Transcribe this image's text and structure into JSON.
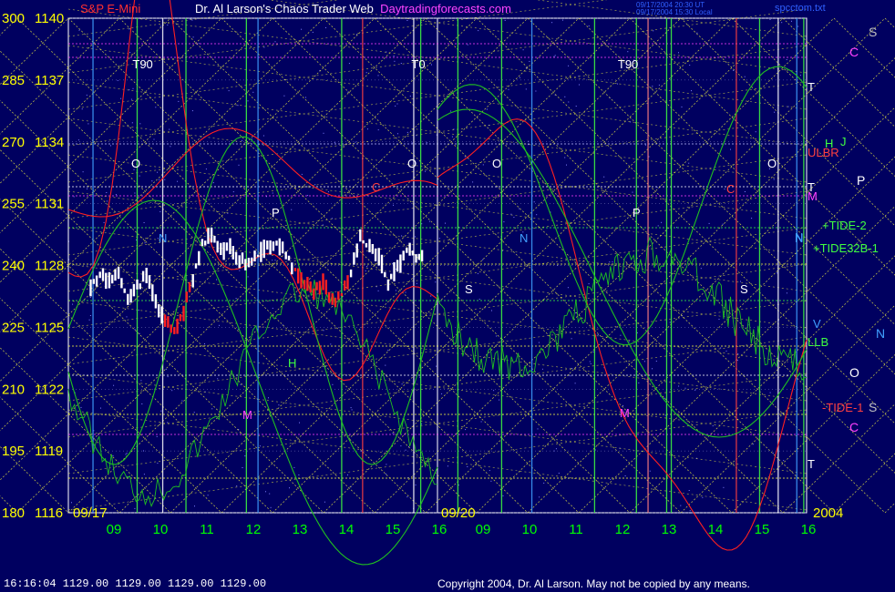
{
  "header": {
    "symbol": "S&P E-Mini",
    "title": "Dr. Al Larson's Chaos Trader Web",
    "site": "Daytradingforecasts.com",
    "file": "spcctom.txt",
    "stamp1": "09/17/2004 20:30 UT",
    "stamp2": "09/17/2004 15:30 Local"
  },
  "status_line": "16:16:04   1129.00 1129.00 1129.00 1129.00",
  "copyright": "Copyright 2004, Dr. Al Larson. May not be copied by any means.",
  "colors": {
    "background": "#000060",
    "axis_text": "#ffff00",
    "time_text": "#00ff00",
    "flux_red": "#ff2020",
    "flux_green": "#20c020",
    "grid_yellow": "#ffff40",
    "grid_purple": "#ff40ff",
    "price_bars": "#ffffff"
  },
  "chart_data": {
    "type": "line",
    "title": "",
    "y_left_outer": [
      "300",
      "285",
      "270",
      "255",
      "240",
      "225",
      "210",
      "195",
      "180"
    ],
    "y_left_inner": [
      "1140",
      "1137",
      "1134",
      "1131",
      "1128",
      "1125",
      "1122",
      "1119",
      "1116"
    ],
    "ylim": [
      1116,
      1140
    ],
    "date_labels": [
      "09/17",
      "09/20",
      "2004"
    ],
    "day1_hours": [
      "09",
      "10",
      "11",
      "12",
      "13",
      "14",
      "15",
      "16"
    ],
    "day2_hours": [
      "09",
      "10",
      "11",
      "12",
      "13",
      "14",
      "15",
      "16"
    ],
    "annotations_top": [
      "T90",
      "T0",
      "T90"
    ],
    "planet_markers": [
      {
        "label": "S",
        "color": "#c0c0c0"
      },
      {
        "label": "C",
        "color": "#ff40ff"
      },
      {
        "label": "P",
        "color": "#ffffff"
      },
      {
        "label": "N",
        "color": "#40a0ff"
      },
      {
        "label": "O",
        "color": "#ffffff"
      },
      {
        "label": "C",
        "color": "#ff40ff"
      },
      {
        "label": "S",
        "color": "#c0c0c0"
      }
    ],
    "right_labels": [
      {
        "label": "T",
        "color": "#ffffff"
      },
      {
        "label": "H",
        "color": "#40ff40"
      },
      {
        "label": "J",
        "color": "#40ff40"
      },
      {
        "label": "ULBR",
        "color": "#ff4040"
      },
      {
        "label": "T",
        "color": "#ffffff"
      },
      {
        "label": "M",
        "color": "#ff40ff"
      },
      {
        "label": "+TIDE-2",
        "color": "#40ff40"
      },
      {
        "label": "N",
        "color": "#40a0ff"
      },
      {
        "label": "+TIDE32B-1",
        "color": "#40ff40"
      },
      {
        "label": "V",
        "color": "#40a0ff"
      },
      {
        "label": "LLB",
        "color": "#40ff40"
      },
      {
        "label": "-TIDE-1",
        "color": "#ff4040"
      },
      {
        "label": "T",
        "color": "#ffffff"
      }
    ],
    "chart_letters": [
      {
        "label": "O",
        "color": "#ffffff"
      },
      {
        "label": "N",
        "color": "#40a0ff"
      },
      {
        "label": "P",
        "color": "#ffffff"
      },
      {
        "label": "H",
        "color": "#40ff40"
      },
      {
        "label": "M",
        "color": "#ff40ff"
      },
      {
        "label": "O",
        "color": "#ffffff"
      },
      {
        "label": "C",
        "color": "#ff4040"
      },
      {
        "label": "O",
        "color": "#ffffff"
      },
      {
        "label": "S",
        "color": "#ffffff"
      },
      {
        "label": "N",
        "color": "#40a0ff"
      },
      {
        "label": "P",
        "color": "#ffffff"
      },
      {
        "label": "M",
        "color": "#ff40ff"
      },
      {
        "label": "C",
        "color": "#ff4040"
      },
      {
        "label": "S",
        "color": "#ffffff"
      },
      {
        "label": "O",
        "color": "#ffffff"
      },
      {
        "label": "N",
        "color": "#40a0ff"
      }
    ],
    "price_series": {
      "name": "",
      "x": [
        0,
        0.2,
        0.4,
        0.6,
        0.8,
        1.0,
        1.2,
        1.4,
        1.6,
        1.8,
        2.0,
        2.2,
        2.4,
        2.6,
        2.8,
        3.0,
        3.2,
        3.4,
        3.6,
        3.8,
        4.0,
        4.2,
        4.4,
        4.6,
        4.8,
        5.0,
        5.2,
        5.4,
        5.6,
        5.8,
        6.0,
        6.2,
        6.4,
        6.6,
        6.8,
        7.0
      ],
      "y": [
        1127.0,
        1127.6,
        1127.2,
        1127.8,
        1126.4,
        1126.9,
        1127.5,
        1126.3,
        1125.3,
        1124.9,
        1125.7,
        1127.4,
        1129.0,
        1129.5,
        1128.6,
        1128.9,
        1128.2,
        1128.1,
        1128.5,
        1129.0,
        1129.2,
        1128.6,
        1127.8,
        1127.1,
        1126.8,
        1127.2,
        1126.3,
        1126.6,
        1127.6,
        1129.3,
        1128.8,
        1128.4,
        1127.3,
        1127.9,
        1128.7,
        1128.5
      ]
    }
  }
}
